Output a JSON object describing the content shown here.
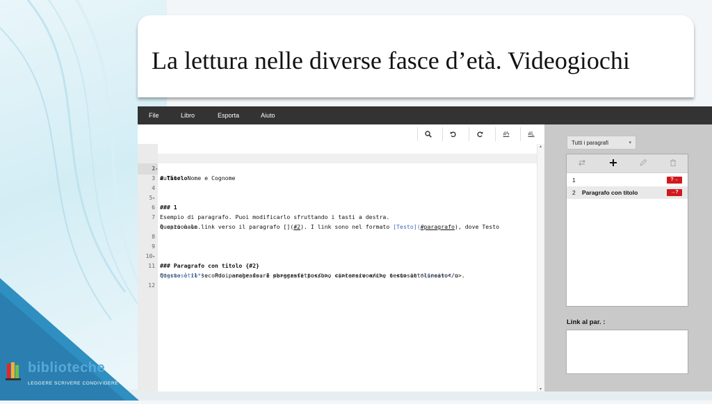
{
  "slide": {
    "title": "La lettura nelle diverse fasce d’età. Videogiochi"
  },
  "logo": {
    "name": "biblioteche",
    "tagline": "LEGGERE SCRIVERE CONDIVIDERE"
  },
  "menu": {
    "items": [
      {
        "label": "File"
      },
      {
        "label": "Libro"
      },
      {
        "label": "Esporta"
      },
      {
        "label": "Aiuto"
      }
    ]
  },
  "toolbar": {
    "buttons": [
      {
        "icon": "search-icon",
        "label": ""
      },
      {
        "icon": "undo-icon",
        "label": ""
      },
      {
        "icon": "redo-icon",
        "label": ""
      },
      {
        "icon": "hash-lightning-icon",
        "label": "#ϟ"
      },
      {
        "icon": "hash-link-icon",
        "label": "#L"
      }
    ]
  },
  "editor": {
    "lines": [
      {
        "n": "1",
        "fold": true
      },
      {
        "n": "2"
      },
      {
        "n": "3"
      },
      {
        "n": "4"
      },
      {
        "n": "5",
        "fold": true
      },
      {
        "n": "6"
      },
      {
        "n": "7"
      },
      {
        "n": ""
      },
      {
        "n": "8"
      },
      {
        "n": "9"
      },
      {
        "n": "10",
        "fold": true
      },
      {
        "n": "11"
      },
      {
        "n": ""
      },
      {
        "n": "12"
      }
    ],
    "text": {
      "l1": "# Titolo",
      "l2": "author: Nome e Cognome",
      "l5": "### 1",
      "l6": "Esempio di paragrafo. Puoi modificarlo sfruttando i tasti a destra.",
      "l7a": "Questo è un link verso il paragrafo [](",
      "l7b": "#2",
      "l7c": "). I link sono nel formato ",
      "l7d": "[Testo](",
      "l7e": "#paragrafo",
      "l7f": "), dove Testo",
      "l7g": "è opzionale.",
      "l10": "### Paragrafo con titolo {#2}",
      "l11a": "Questo è il secondo paragrafo. I paragrafi possono contenere anche testo in ",
      "l11b": "*corsivo*",
      "l11c": " o",
      "l11d": "**grassetto**",
      "l11e": ".  Puoi anche usare <b>grassetto</b>, <i>corsivo</i>, o <u>sottolineato</u>."
    }
  },
  "side": {
    "filter": "Tutti i paragrafi",
    "paragraphs": [
      {
        "num": "1",
        "title": "",
        "badge": "?→"
      },
      {
        "num": "2",
        "title": "Paragrafo con titolo",
        "badge": "→?"
      }
    ],
    "link_label": "Link al par. :"
  },
  "colors": {
    "menubar": "#333333",
    "badge": "#d0191d",
    "panel_bg": "#c9c9c9",
    "link_text": "#3b6fb6"
  }
}
